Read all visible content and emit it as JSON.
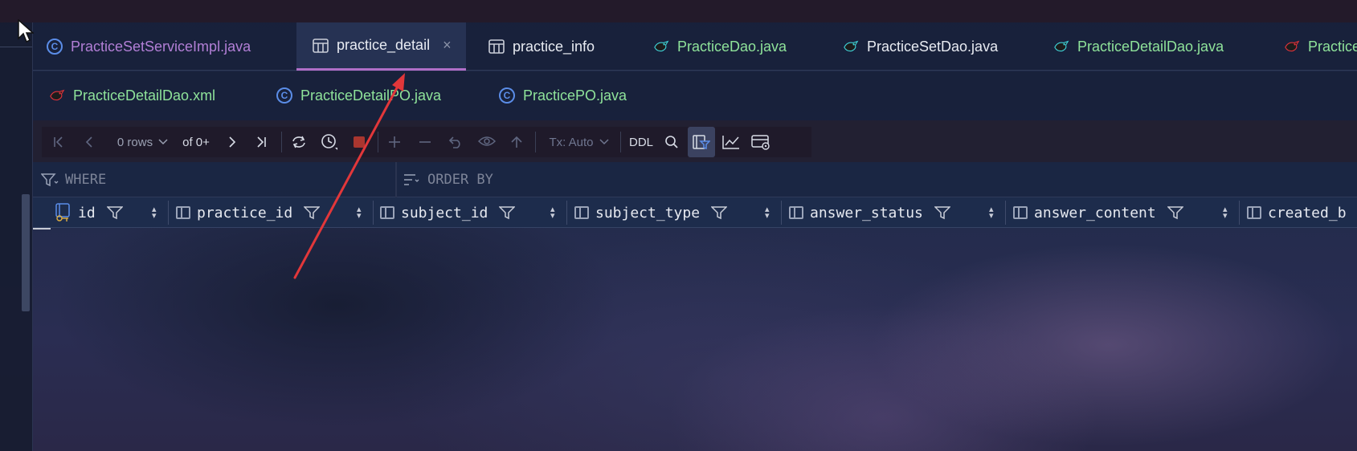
{
  "tabs_row1": [
    {
      "label": "PracticeSetServiceImpl.java",
      "icon": "class-icon",
      "color": "#b27fd6"
    },
    {
      "label": "practice_detail",
      "icon": "table-icon",
      "color": "#e8ebf2",
      "active": true
    },
    {
      "label": "practice_info",
      "icon": "table-icon",
      "color": "#e8ebf2"
    },
    {
      "label": "PracticeDao.java",
      "icon": "mybatis-icon",
      "color": "#8fe39a"
    },
    {
      "label": "PracticeSetDao.java",
      "icon": "mybatis-icon",
      "color": "#e8ebf2"
    },
    {
      "label": "PracticeDetailDao.java",
      "icon": "mybatis-icon",
      "color": "#8fe39a"
    },
    {
      "label": "Practice",
      "icon": "mybatis-red-icon",
      "color": "#8fe39a"
    }
  ],
  "tabs_row2": [
    {
      "label": "PracticeDetailDao.xml",
      "icon": "mybatis-red-icon",
      "color": "#8fe39a"
    },
    {
      "label": "PracticeDetailPO.java",
      "icon": "class-icon",
      "color": "#8fe39a"
    },
    {
      "label": "PracticePO.java",
      "icon": "class-icon",
      "color": "#8fe39a"
    }
  ],
  "class_glyph": "C",
  "close_glyph": "×",
  "toolbar": {
    "rows": "0 rows",
    "of": "of 0+",
    "tx": "Tx: Auto",
    "ddl": "DDL"
  },
  "filters": {
    "where": "WHERE",
    "order_by": "ORDER BY"
  },
  "columns": [
    {
      "name": "id"
    },
    {
      "name": "practice_id"
    },
    {
      "name": "subject_id"
    },
    {
      "name": "subject_type"
    },
    {
      "name": "answer_status"
    },
    {
      "name": "answer_content"
    },
    {
      "name": "created_b"
    }
  ],
  "colors": {
    "accent_tab_underline": "#b06fc8",
    "annotation_arrow": "#e2373a"
  }
}
